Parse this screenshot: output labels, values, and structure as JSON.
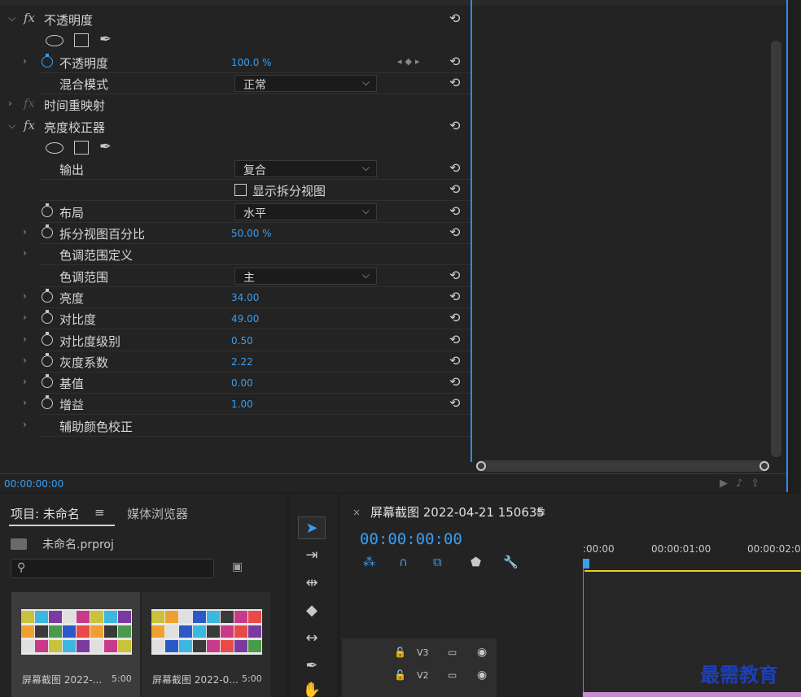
{
  "effect_controls": {
    "rows": [
      {
        "type": "effect",
        "label": "不透明度",
        "expanded": true,
        "fx_enabled": true,
        "reset": true
      },
      {
        "type": "masks"
      },
      {
        "type": "param",
        "label": "不透明度",
        "value": "100.0 %",
        "stopwatch": "active",
        "expander": true,
        "keyframe_nav": true,
        "reset": true
      },
      {
        "type": "dropdown",
        "label": "混合模式",
        "value": "正常",
        "reset": true
      },
      {
        "type": "effect",
        "label": "时间重映射",
        "expanded": false,
        "fx_enabled": false,
        "reset": false
      },
      {
        "type": "effect",
        "label": "亮度校正器",
        "expanded": true,
        "fx_enabled": true,
        "reset": true
      },
      {
        "type": "masks"
      },
      {
        "type": "dropdown",
        "label": "输出",
        "value": "复合",
        "reset": true
      },
      {
        "type": "checkbox",
        "label": "显示拆分视图",
        "checked": false,
        "reset": true
      },
      {
        "type": "dropdown",
        "label": "布局",
        "value": "水平",
        "stopwatch": "normal",
        "reset": true
      },
      {
        "type": "param",
        "label": "拆分视图百分比",
        "value": "50.00 %",
        "stopwatch": "normal",
        "expander": true,
        "reset": true
      },
      {
        "type": "group",
        "label": "色调范围定义",
        "expander": true
      },
      {
        "type": "dropdown",
        "label": "色调范围",
        "value": "主",
        "reset": true
      },
      {
        "type": "param",
        "label": "亮度",
        "value": "34.00",
        "stopwatch": "normal",
        "expander": true,
        "reset": true
      },
      {
        "type": "param",
        "label": "对比度",
        "value": "49.00",
        "stopwatch": "normal",
        "expander": true,
        "reset": true
      },
      {
        "type": "param",
        "label": "对比度级别",
        "value": "0.50",
        "stopwatch": "normal",
        "expander": true,
        "reset": true
      },
      {
        "type": "param",
        "label": "灰度系数",
        "value": "2.22",
        "stopwatch": "normal",
        "expander": true,
        "reset": true
      },
      {
        "type": "param",
        "label": "基值",
        "value": "0.00",
        "stopwatch": "normal",
        "expander": true,
        "reset": true
      },
      {
        "type": "param",
        "label": "增益",
        "value": "1.00",
        "stopwatch": "normal",
        "expander": true,
        "reset": true
      },
      {
        "type": "group",
        "label": "辅助颜色校正",
        "expander": true
      }
    ],
    "footer_timecode": "00:00:00:00",
    "icons": {
      "reset": "reset-icon",
      "pen": "pen-mask-icon",
      "play_only": "play-audio-icon",
      "export": "export-icon"
    }
  },
  "project": {
    "tab_label": "项目: 未命名",
    "menu_glyph": "≡",
    "media_browser_tab": "媒体浏览器",
    "project_file": "未命名.prproj",
    "search_placeholder": "",
    "items": [
      {
        "name": "屏幕截图 2022-...",
        "duration": "5:00",
        "selected": true
      },
      {
        "name": "屏幕截图 2022-0...",
        "duration": "5:00",
        "selected": false
      }
    ]
  },
  "tools": [
    "selection-tool",
    "track-select-tool",
    "ripple-edit-tool",
    "razor-tool",
    "slip-tool",
    "pen-tool",
    "hand-tool"
  ],
  "timeline": {
    "close_glyph": "×",
    "title": "屏幕截图 2022-04-21 150635",
    "menu_glyph": "≡",
    "timecode": "00:00:00:00",
    "ruler_labels": [
      ":00:00",
      "00:00:01:00",
      "00:00:02:0"
    ],
    "tracks": [
      {
        "name": "V3"
      },
      {
        "name": "V2"
      }
    ]
  },
  "watermark": "最需教育",
  "colors": {
    "accent": "#2d8ceb",
    "value_blue": "#3a9ef0",
    "work_area": "#e6d21b",
    "clip": "#c98bd0"
  }
}
